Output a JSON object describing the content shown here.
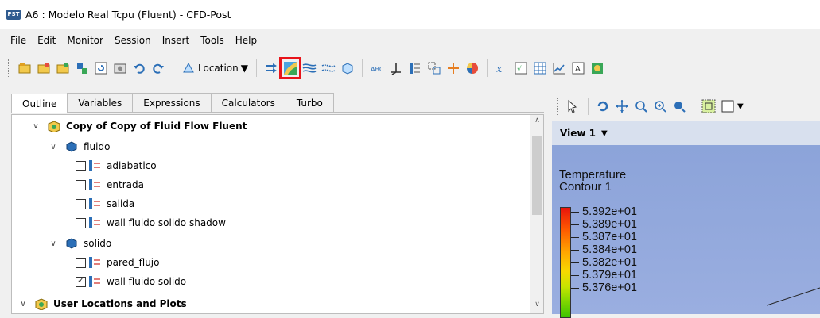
{
  "window": {
    "app_badge": "PST",
    "title": "A6 : Modelo Real Tcpu (Fluent) - CFD-Post"
  },
  "menu": [
    "File",
    "Edit",
    "Monitor",
    "Session",
    "Insert",
    "Tools",
    "Help"
  ],
  "toolbar": {
    "location_label": "Location"
  },
  "tabs": [
    "Outline",
    "Variables",
    "Expressions",
    "Calculators",
    "Turbo"
  ],
  "tree": {
    "root": "Copy of Copy of Fluid Flow Fluent",
    "domain1": {
      "label": "fluido",
      "children": [
        {
          "label": "adiabatico",
          "checked": false
        },
        {
          "label": "entrada",
          "checked": false
        },
        {
          "label": "salida",
          "checked": false
        },
        {
          "label": "wall fluido solido shadow",
          "checked": false
        }
      ]
    },
    "domain2": {
      "label": "solido",
      "children": [
        {
          "label": "pared_flujo",
          "checked": false
        },
        {
          "label": "wall fluido solido",
          "checked": true
        }
      ]
    },
    "next_root": "User Locations and Plots"
  },
  "view": {
    "title": "View 1",
    "legend_title_1": "Temperature",
    "legend_title_2": "Contour 1",
    "legend_values": [
      "5.392e+01",
      "5.389e+01",
      "5.387e+01",
      "5.384e+01",
      "5.382e+01",
      "5.379e+01",
      "5.376e+01"
    ]
  },
  "colors": {
    "highlight": "#e8141a",
    "view_bg": "#8aa2d8",
    "header_bg": "#d8e0ee"
  }
}
